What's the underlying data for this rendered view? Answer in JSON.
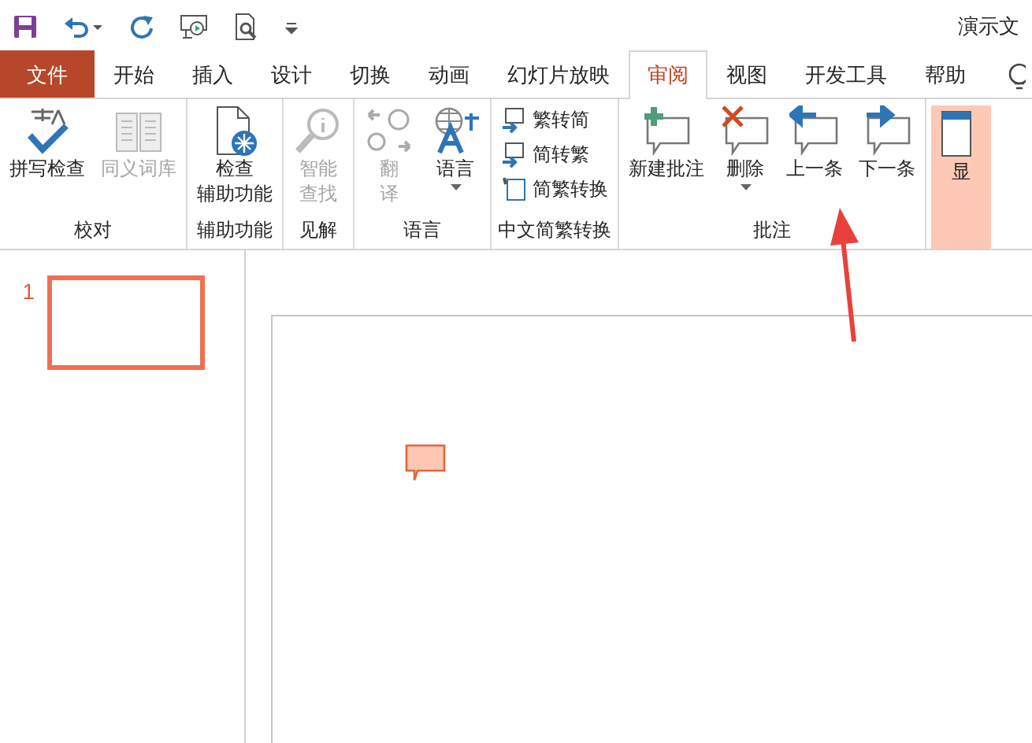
{
  "window": {
    "title": "演示文"
  },
  "tabs": [
    {
      "label": "文件",
      "kind": "file",
      "selected": false
    },
    {
      "label": "开始",
      "kind": "tab",
      "selected": false
    },
    {
      "label": "插入",
      "kind": "tab",
      "selected": false
    },
    {
      "label": "设计",
      "kind": "tab",
      "selected": false
    },
    {
      "label": "切换",
      "kind": "tab",
      "selected": false
    },
    {
      "label": "动画",
      "kind": "tab",
      "selected": false
    },
    {
      "label": "幻灯片放映",
      "kind": "tab",
      "selected": false
    },
    {
      "label": "审阅",
      "kind": "tab",
      "selected": true
    },
    {
      "label": "视图",
      "kind": "tab",
      "selected": false
    },
    {
      "label": "开发工具",
      "kind": "tab",
      "selected": false
    },
    {
      "label": "帮助",
      "kind": "tab",
      "selected": false
    }
  ],
  "ribbon": {
    "groups": [
      {
        "label": "校对",
        "items": [
          {
            "kind": "large",
            "lines": [
              "拼写检查"
            ],
            "disabled": false,
            "dropdown": false
          },
          {
            "kind": "large",
            "lines": [
              "同义词库"
            ],
            "disabled": true,
            "dropdown": false
          }
        ]
      },
      {
        "label": "辅助功能",
        "items": [
          {
            "kind": "large",
            "lines": [
              "检查",
              "辅助功能"
            ],
            "disabled": false,
            "dropdown": false
          }
        ]
      },
      {
        "label": "见解",
        "items": [
          {
            "kind": "large",
            "lines": [
              "智能",
              "查找"
            ],
            "disabled": true,
            "dropdown": false
          }
        ]
      },
      {
        "label": "语言",
        "items": [
          {
            "kind": "large",
            "lines": [
              "翻",
              "译"
            ],
            "disabled": true,
            "dropdown": false
          },
          {
            "kind": "large",
            "lines": [
              "语言"
            ],
            "disabled": false,
            "dropdown": true
          }
        ]
      },
      {
        "label": "中文简繁转换",
        "items": [
          {
            "kind": "small",
            "lines": [
              "繁转简"
            ],
            "disabled": false,
            "dropdown": false
          },
          {
            "kind": "small",
            "lines": [
              "简转繁"
            ],
            "disabled": false,
            "dropdown": false
          },
          {
            "kind": "small",
            "lines": [
              "简繁转换"
            ],
            "disabled": false,
            "dropdown": false
          }
        ]
      },
      {
        "label": "批注",
        "items": [
          {
            "kind": "large",
            "lines": [
              "新建批注"
            ],
            "disabled": false,
            "dropdown": false
          },
          {
            "kind": "large",
            "lines": [
              "删除"
            ],
            "disabled": false,
            "dropdown": true
          },
          {
            "kind": "large",
            "lines": [
              "上一条"
            ],
            "disabled": false,
            "dropdown": false
          },
          {
            "kind": "large",
            "lines": [
              "下一条"
            ],
            "disabled": false,
            "dropdown": false
          }
        ]
      },
      {
        "items": [
          {
            "kind": "large",
            "lines": [
              "显"
            ],
            "disabled": false,
            "dropdown": false,
            "on": true
          }
        ]
      }
    ]
  },
  "slides_pane": {
    "thumbnails": [
      {
        "number": "1",
        "selected": true
      }
    ]
  }
}
